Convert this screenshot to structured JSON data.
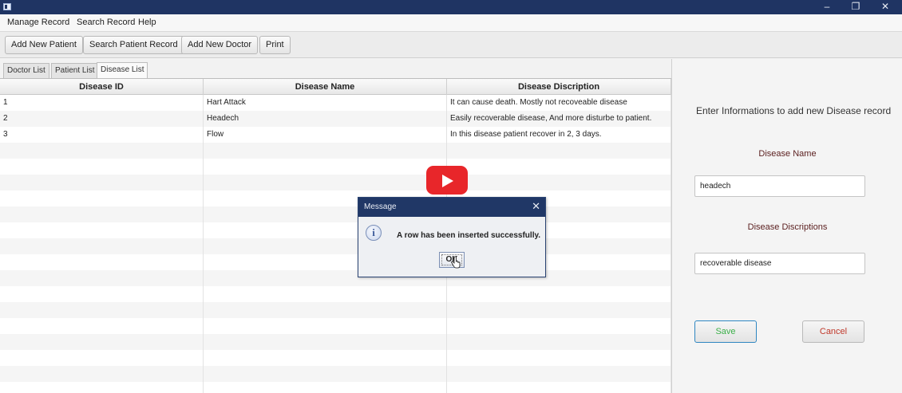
{
  "menu": [
    "Manage Record",
    "Search Record",
    "Help"
  ],
  "toolbar": [
    "Add New Patient",
    "Search Patient Record",
    "Add New Doctor",
    "Print"
  ],
  "tabs": [
    "Doctor List",
    "Patient List",
    "Disease List"
  ],
  "table": {
    "columns": [
      "Disease ID",
      "Disease Name",
      "Disease Discription"
    ],
    "rows": [
      [
        "1",
        "Hart Attack",
        "It can cause death. Mostly not recoveable disease"
      ],
      [
        "2",
        "Headech",
        "Easily recoverable disease, And more disturbe to patient."
      ],
      [
        "3",
        "Flow",
        "In this disease patient recover in 2, 3 days."
      ]
    ]
  },
  "form": {
    "title": "Enter Informations to add new Disease record",
    "name_label": "Disease Name",
    "name_value": "headech",
    "desc_label": "Disease Discriptions",
    "desc_value": "recoverable disease",
    "save_label": "Save",
    "cancel_label": "Cancel"
  },
  "dialog": {
    "title": "Message",
    "message": "A row has been inserted successfully.",
    "ok_label": "OK",
    "icon": "info-icon"
  },
  "window": {
    "minimize": "–",
    "restore": "❐",
    "close": "✕"
  },
  "colors": {
    "titlebar": "#1f3463",
    "label": "#5a1e1e",
    "save_text": "#3cb04a",
    "cancel_text": "#c0392b",
    "save_border": "#2e86c1"
  }
}
